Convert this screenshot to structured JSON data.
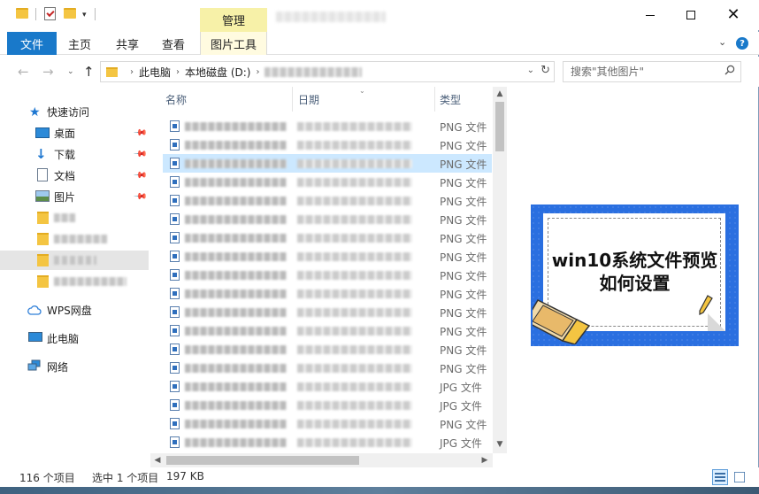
{
  "titlebar": {
    "manage_tab": "管理",
    "window_controls": {
      "minimize": "minimize-icon",
      "maximize": "maximize-icon",
      "close": "close-icon"
    }
  },
  "ribbon": {
    "file_tab": "文件",
    "tabs": [
      "主页",
      "共享",
      "查看",
      "图片工具"
    ],
    "expand_icon": "chevron-down-icon",
    "help_icon": "?"
  },
  "address": {
    "crumbs": [
      "此电脑",
      "本地磁盘 (D:)"
    ],
    "search_placeholder": "搜索\"其他图片\""
  },
  "nav": {
    "items": [
      {
        "label": "快速访问",
        "icon": "star-icon"
      },
      {
        "label": "桌面",
        "icon": "desktop-icon",
        "pinned": true
      },
      {
        "label": "下载",
        "icon": "download-icon",
        "pinned": true
      },
      {
        "label": "文档",
        "icon": "document-icon",
        "pinned": true
      },
      {
        "label": "图片",
        "icon": "picture-icon",
        "pinned": true
      },
      {
        "label": "WPS网盘",
        "icon": "cloud-icon"
      },
      {
        "label": "此电脑",
        "icon": "computer-icon"
      },
      {
        "label": "网络",
        "icon": "network-icon"
      }
    ]
  },
  "columns": {
    "name": "名称",
    "date": "日期",
    "type": "类型"
  },
  "files": [
    {
      "type": "PNG 文件"
    },
    {
      "type": "PNG 文件"
    },
    {
      "type": "PNG 文件",
      "selected": true
    },
    {
      "type": "PNG 文件"
    },
    {
      "type": "PNG 文件"
    },
    {
      "type": "PNG 文件"
    },
    {
      "type": "PNG 文件"
    },
    {
      "type": "PNG 文件"
    },
    {
      "type": "PNG 文件"
    },
    {
      "type": "PNG 文件"
    },
    {
      "type": "PNG 文件"
    },
    {
      "type": "PNG 文件"
    },
    {
      "type": "PNG 文件"
    },
    {
      "type": "PNG 文件"
    },
    {
      "type": "JPG 文件"
    },
    {
      "type": "JPG 文件"
    },
    {
      "type": "PNG 文件"
    },
    {
      "type": "JPG 文件"
    }
  ],
  "preview": {
    "title_line1": "win10系统文件预览",
    "title_line2": "如何设置"
  },
  "status": {
    "count": "116 个项目",
    "selected": "选中 1 个项目",
    "size": "197 KB"
  }
}
